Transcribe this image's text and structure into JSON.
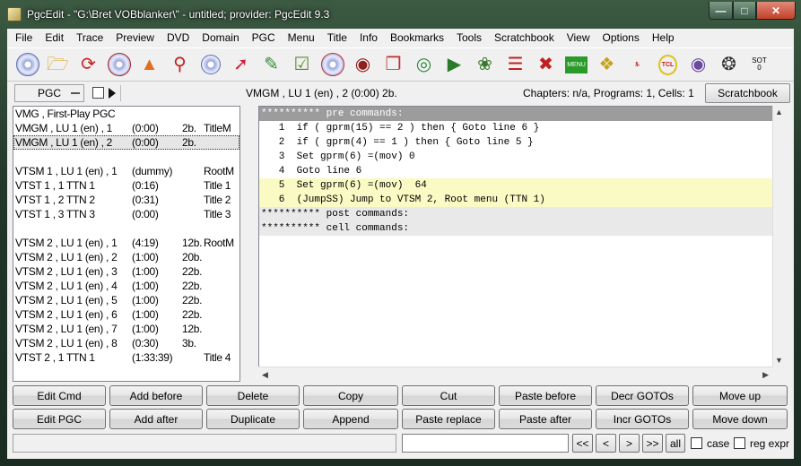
{
  "window": {
    "title": "PgcEdit -   \"G:\\Bret VOBblanker\\\" - untitled; provider: PgcEdit 9.3"
  },
  "menubar": {
    "items": [
      "File",
      "Edit",
      "Trace",
      "Preview",
      "DVD",
      "Domain",
      "PGC",
      "Menu",
      "Title",
      "Info",
      "Bookmarks",
      "Tools",
      "Scratchbook",
      "View",
      "Options",
      "Help"
    ]
  },
  "toolbar": {
    "icons": [
      "open-disc-icon",
      "open-folder-icon",
      "reload-icon",
      "save-disc-icon",
      "rocket-icon",
      "search-disc-icon",
      "multi-disc-icon",
      "pin-icon",
      "script-icon",
      "checklist-icon",
      "stop-disc-icon",
      "disc-film-icon",
      "copy-pages-icon",
      "globe-icon",
      "play-preview-icon",
      "bug-icon",
      "list-icon",
      "film-cross-icon",
      "menu-icon",
      "chain-icon",
      "numbers-icon",
      "tcl-icon",
      "eye-icon",
      "compass-icon",
      "sot-icon"
    ],
    "menu_label": "MENU",
    "tcl_label": "TCL",
    "sot_label": "SOT",
    "sot_value": "0"
  },
  "strip": {
    "pgc_label": "PGC",
    "location": "VMGM , LU 1 (en) , 2  (0:00)  2b.",
    "counts": "Chapters: n/a,  Programs: 1,  Cells: 1",
    "scratchbook_label": "Scratchbook"
  },
  "pgc_list": [
    {
      "c1": "VMG , First-Play PGC",
      "c2": "",
      "c3": "",
      "c4": ""
    },
    {
      "c1": "VMGM , LU 1 (en) , 1",
      "c2": "(0:00)",
      "c3": "2b.",
      "c4": "TitleM"
    },
    {
      "c1": "VMGM , LU 1 (en) , 2",
      "c2": "(0:00)",
      "c3": "2b.",
      "c4": "",
      "selected": true
    },
    {
      "c1": "",
      "c2": "",
      "c3": "",
      "c4": ""
    },
    {
      "c1": "VTSM 1 , LU 1 (en) , 1",
      "c2": "(dummy)",
      "c3": "",
      "c4": "RootM"
    },
    {
      "c1": "VTST 1 , 1        TTN 1",
      "c2": "(0:16)",
      "c3": "",
      "c4": "Title 1"
    },
    {
      "c1": "VTST 1 , 2        TTN 2",
      "c2": "(0:31)",
      "c3": "",
      "c4": "Title 2"
    },
    {
      "c1": "VTST 1 , 3        TTN 3",
      "c2": "(0:00)",
      "c3": "",
      "c4": "Title 3"
    },
    {
      "c1": "",
      "c2": "",
      "c3": "",
      "c4": ""
    },
    {
      "c1": "VTSM 2 , LU 1 (en) , 1",
      "c2": "(4:19)",
      "c3": "12b.",
      "c4": "RootM"
    },
    {
      "c1": "VTSM 2 , LU 1 (en) , 2",
      "c2": "(1:00)",
      "c3": "20b.",
      "c4": ""
    },
    {
      "c1": "VTSM 2 , LU 1 (en) , 3",
      "c2": "(1:00)",
      "c3": "22b.",
      "c4": ""
    },
    {
      "c1": "VTSM 2 , LU 1 (en) , 4",
      "c2": "(1:00)",
      "c3": "22b.",
      "c4": ""
    },
    {
      "c1": "VTSM 2 , LU 1 (en) , 5",
      "c2": "(1:00)",
      "c3": "22b.",
      "c4": ""
    },
    {
      "c1": "VTSM 2 , LU 1 (en) , 6",
      "c2": "(1:00)",
      "c3": "22b.",
      "c4": ""
    },
    {
      "c1": "VTSM 2 , LU 1 (en) , 7",
      "c2": "(1:00)",
      "c3": "12b.",
      "c4": ""
    },
    {
      "c1": "VTSM 2 , LU 1 (en) , 8",
      "c2": "(0:30)",
      "c3": "3b.",
      "c4": ""
    },
    {
      "c1": "VTST 2 , 1        TTN 1",
      "c2": "(1:33:39)",
      "c3": "",
      "c4": "Title 4"
    }
  ],
  "code_lines": [
    {
      "text": "********** pre commands:",
      "style": "hdr-grey"
    },
    {
      "text": "   1  if ( gprm(15) == 2 ) then { Goto line 6 }",
      "style": ""
    },
    {
      "text": "   2  if ( gprm(4) == 1 ) then { Goto line 5 }",
      "style": ""
    },
    {
      "text": "   3  Set gprm(6) =(mov) 0",
      "style": ""
    },
    {
      "text": "   4  Goto line 6",
      "style": ""
    },
    {
      "text": "   5  Set gprm(6) =(mov)  64",
      "style": "hl"
    },
    {
      "text": "   6  (JumpSS) Jump to VTSM 2, Root menu (TTN 1)",
      "style": "hl"
    },
    {
      "text": "********** post commands:",
      "style": "hdr-light"
    },
    {
      "text": "********** cell commands:",
      "style": "hdr-light"
    }
  ],
  "buttons": {
    "row1": [
      "Edit Cmd",
      "Add before",
      "Delete",
      "Copy",
      "Cut",
      "Paste before",
      "Decr GOTOs",
      "Move up"
    ],
    "row2": [
      "Edit PGC",
      "Add after",
      "Duplicate",
      "Append",
      "Paste replace",
      "Paste after",
      "Incr GOTOs",
      "Move down"
    ]
  },
  "search": {
    "value": "",
    "first": "<<",
    "prev": "<",
    "next": ">",
    "last": ">>",
    "all": "all",
    "case_label": "case",
    "regex_label": "reg expr"
  }
}
